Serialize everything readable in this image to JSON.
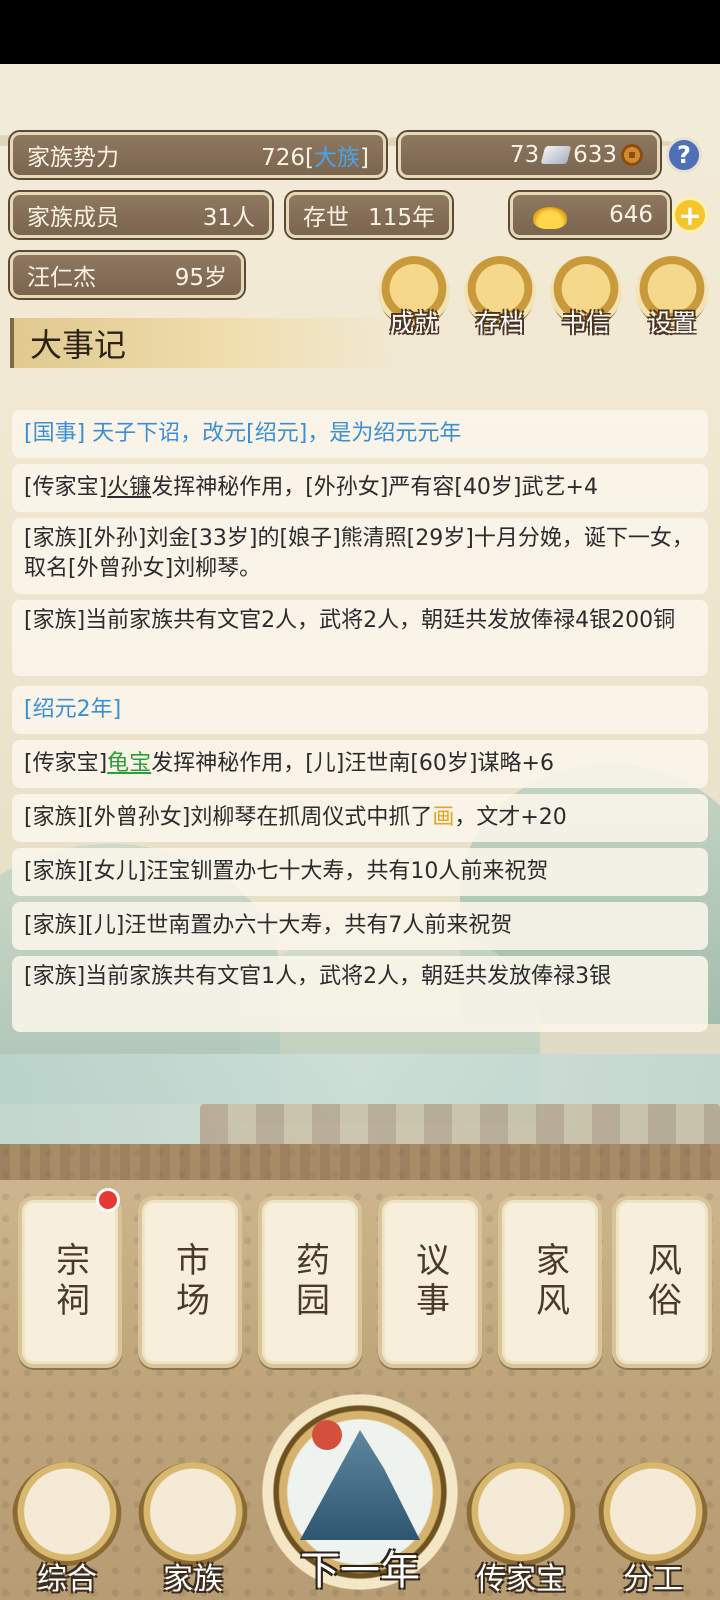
{
  "header": {
    "family_power_label": "家族势力",
    "family_power_value": "726",
    "family_power_open": "[",
    "family_power_level": "大族",
    "family_power_close": "]",
    "silver": "73",
    "copper": "633",
    "members_label": "家族成员",
    "members_value": "31人",
    "existence_label": "存世",
    "existence_value": "115年",
    "gold": "646",
    "leader_name": "汪仁杰",
    "leader_age": "95岁"
  },
  "menu": [
    {
      "label": "成就",
      "icon": "achievement-icon"
    },
    {
      "label": "存档",
      "icon": "save-icon"
    },
    {
      "label": "书信",
      "icon": "letter-icon"
    },
    {
      "label": "设置",
      "icon": "settings-icon"
    }
  ],
  "chronicle": {
    "title": "大事记",
    "events": {
      "e1": "[国事] 天子下诏，改元[绍元]，是为绍元元年",
      "e2a": "[传家宝]",
      "e2b": "火镰",
      "e2c": "发挥神秘作用，[外孙女]严有容[40岁]武艺+4",
      "e3": "[家族][外孙]刘金[33岁]的[娘子]熊清照[29岁]十月分娩，诞下一女，取名[外曾孙女]刘柳琴。",
      "e4": "[家族]当前家族共有文官2人，武将2人，朝廷共发放俸禄4银200铜",
      "e5": "[绍元2年]",
      "e6a": "[传家宝]",
      "e6b": "龟宝",
      "e6c": "发挥神秘作用，[儿]汪世南[60岁]谋略+6",
      "e7a": "[家族][外曾孙女]刘柳琴在抓周仪式中抓了",
      "e7b": "画",
      "e7c": "，文才+20",
      "e8": "[家族][女儿]汪宝钏置办七十大寿，共有10人前来祝贺",
      "e9": "[家族][儿]汪世南置办六十大寿，共有7人前来祝贺",
      "e10": "[家族]当前家族共有文官1人，武将2人，朝廷共发放俸禄3银"
    }
  },
  "buildings": [
    "宗祠",
    "市场",
    "药园",
    "议事",
    "家风",
    "风俗"
  ],
  "nav": {
    "overview": "综合",
    "family": "家族",
    "next_year": "下一年",
    "heirloom": "传家宝",
    "division": "分工"
  },
  "colors": {
    "accent_blue": "#3a8fd6",
    "heirloom_green": "#2aa03b",
    "item_orange": "#e8a21e",
    "badge_red": "#e53935"
  }
}
